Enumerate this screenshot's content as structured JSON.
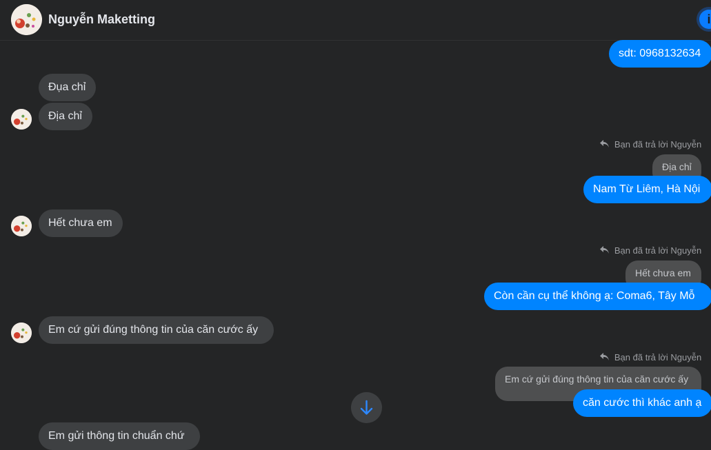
{
  "header": {
    "contact_name": "Nguyễn Maketting",
    "info_label": "i"
  },
  "messages": {
    "m1": "sdt: 0968132634",
    "m2": "Đụa chỉ",
    "m3": "Địa chỉ",
    "m4_reply_label": "Bạn đã trả lời Nguyễn",
    "m4_quote": "Địa chỉ",
    "m4": "Nam Từ Liêm, Hà Nội",
    "m5": "Hết chưa em",
    "m6_reply_label": "Bạn đã trả lời Nguyễn",
    "m6_quote": "Hết chưa em",
    "m6": "Còn cần cụ thể không ạ:  Coma6, Tây Mỗ",
    "m7": "Em cứ gửi đúng thông tin của căn cước ấy",
    "m8_reply_label": "Bạn đã trả lời Nguyễn",
    "m8_quote": "Em cứ gửi đúng thông tin của căn cước ấy",
    "m8": "căn cước thì khác anh ạ",
    "m9": "Em gửi thông tin chuẩn chứ"
  },
  "colors": {
    "background": "#242526",
    "incoming_bubble": "#3e4042",
    "outgoing_bubble": "#0084ff",
    "accent": "#0a7cff"
  },
  "icons": {
    "reply": "reply-arrow-icon",
    "scroll": "arrow-down-icon",
    "info": "info-icon"
  }
}
